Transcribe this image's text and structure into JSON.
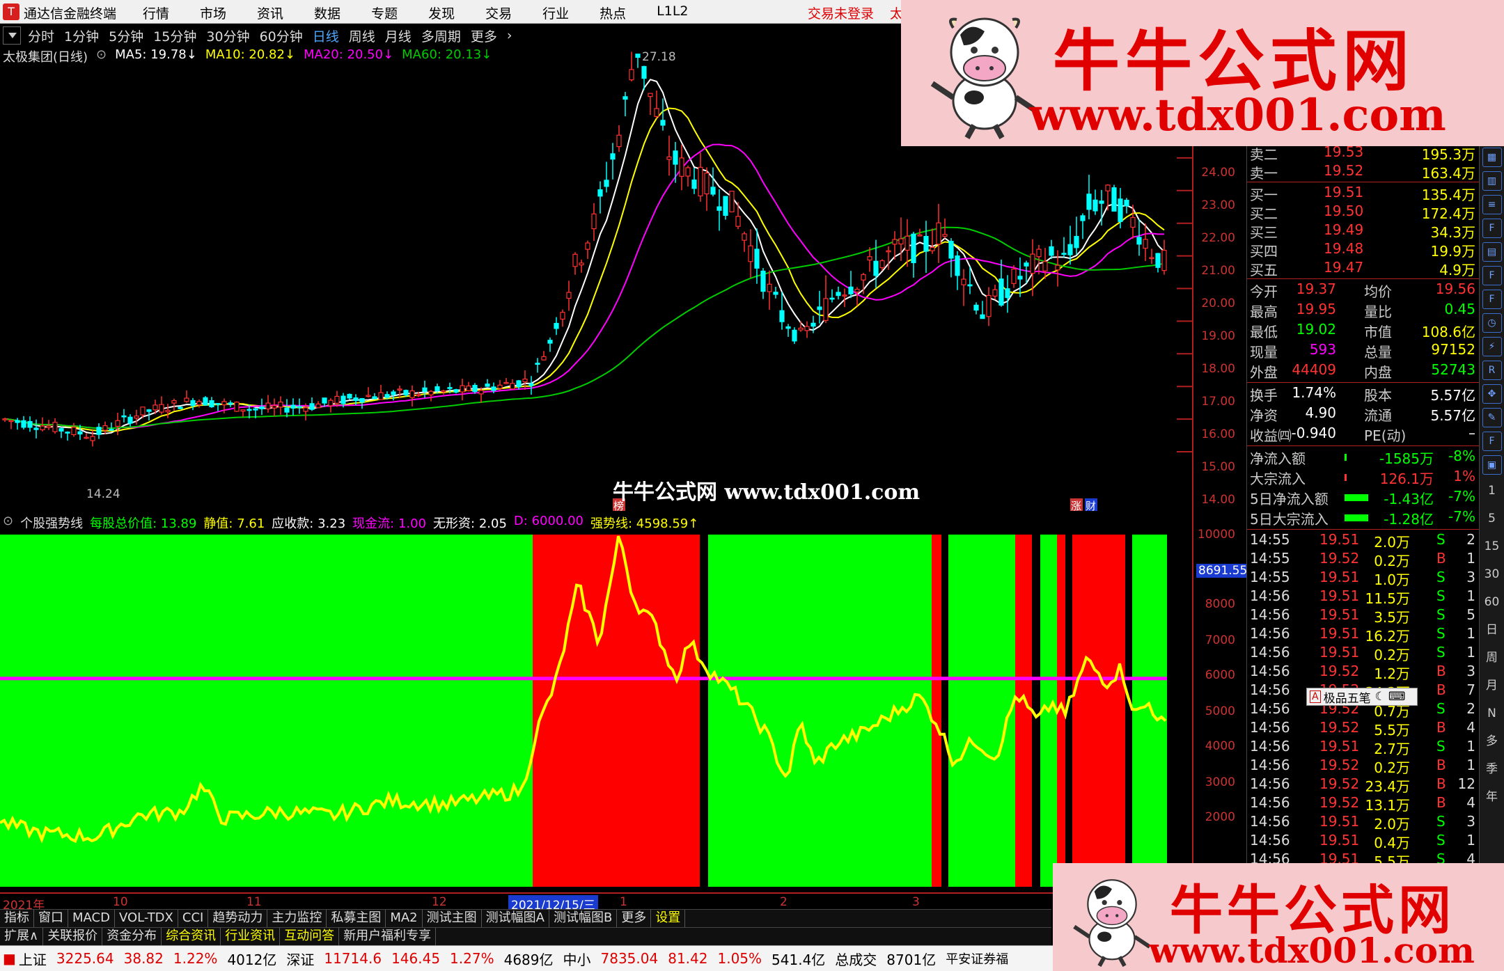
{
  "menubar": {
    "app_title": "通达信金融终端",
    "items": [
      "行情",
      "市场",
      "资讯",
      "数据",
      "专题",
      "发现",
      "交易",
      "行业",
      "热点",
      "L1L2"
    ],
    "trade_status": "交易未登录",
    "trade_status_extra": "太"
  },
  "periods": {
    "items": [
      "分时",
      "1分钟",
      "5分钟",
      "15分钟",
      "30分钟",
      "60分钟",
      "日线",
      "周线",
      "月线",
      "多周期",
      "更多"
    ],
    "active": "日线"
  },
  "main_title": {
    "stock": "太极集团(日线)",
    "ma5": "MA5: 19.78↓",
    "ma10": "MA10: 20.82↓",
    "ma20": "MA20: 20.50↓",
    "ma60": "MA60: 20.13↓",
    "high_label": "27.18",
    "low_label": "14.24",
    "badge1": "榜",
    "badge2": "涨",
    "badge3": "财"
  },
  "indicator_title": {
    "name": "个股强势线",
    "f1": "每股总价值: 13.89",
    "f2": "静值: 7.61",
    "f3": "应收款: 3.23",
    "f4": "现金流: 1.00",
    "f5": "无形资: 2.05",
    "f6": "D: 6000.00",
    "f7": "强势线: 4598.59↑",
    "current_value": "8691.55"
  },
  "axis_main": [
    "24.00",
    "23.00",
    "22.00",
    "21.00",
    "20.00",
    "19.00",
    "18.00",
    "17.00",
    "16.00",
    "15.00",
    "14.00"
  ],
  "axis_ind": [
    "10000",
    "8000",
    "7000",
    "6000",
    "5000",
    "4000",
    "3000",
    "2000"
  ],
  "dates": {
    "y": "2021年",
    "m10": "10",
    "m11": "11",
    "m12": "12",
    "sel": "2021/12/15/三",
    "m1": "1",
    "m2": "2",
    "m3": "3"
  },
  "tabs1": [
    "指标",
    "窗口",
    "MACD",
    "VOL-TDX",
    "CCI",
    "趋势动力",
    "主力监控",
    "私募主图",
    "MA2",
    "测试主图",
    "测试幅图A",
    "测试幅图B",
    "更多",
    "设置"
  ],
  "tabs2": [
    "扩展∧",
    "关联报价",
    "资金分布",
    "综合资讯",
    "行业资讯",
    "互动问答",
    "新用户福利专享"
  ],
  "statusbar": {
    "sh_label": "上证",
    "sh_val": "3225.64",
    "sh_chg": "38.82",
    "sh_pct": "1.22%",
    "sh_amt": "4012亿",
    "sz_label": "深证",
    "sz_val": "11714.6",
    "sz_chg": "146.45",
    "sz_pct": "1.27%",
    "sz_amt": "4689亿",
    "zx_label": "中小",
    "zx_val": "7835.04",
    "zx_chg": "81.42",
    "zx_pct": "1.05%",
    "zx_amt": "541.4亿",
    "total_label": "总成交",
    "total_val": "8701亿",
    "broker": "平安证券福"
  },
  "quotes": {
    "sell": [
      {
        "label": "卖二",
        "price": "19.53",
        "vol": "195.3万"
      },
      {
        "label": "卖一",
        "price": "19.52",
        "vol": "163.4万"
      }
    ],
    "buy": [
      {
        "label": "买一",
        "price": "19.51",
        "vol": "135.4万"
      },
      {
        "label": "买二",
        "price": "19.50",
        "vol": "172.4万"
      },
      {
        "label": "买三",
        "price": "19.49",
        "vol": "34.3万"
      },
      {
        "label": "买四",
        "price": "19.48",
        "vol": "19.9万"
      },
      {
        "label": "买五",
        "price": "19.47",
        "vol": "4.9万"
      }
    ],
    "stats": [
      {
        "l1": "今开",
        "v1": "19.37",
        "l2": "均价",
        "v2": "19.56"
      },
      {
        "l1": "最高",
        "v1": "19.95",
        "l2": "量比",
        "v2": "0.45"
      },
      {
        "l1": "最低",
        "v1": "19.02",
        "l2": "市值",
        "v2": "108.6亿"
      },
      {
        "l1": "现量",
        "v1": "593",
        "l2": "总量",
        "v2": "97152"
      },
      {
        "l1": "外盘",
        "v1": "44409",
        "l2": "内盘",
        "v2": "52743"
      }
    ],
    "fin": [
      {
        "l1": "换手",
        "v1": "1.74%",
        "l2": "股本",
        "v2": "5.57亿"
      },
      {
        "l1": "净资",
        "v1": "4.90",
        "l2": "流通",
        "v2": "5.57亿"
      },
      {
        "l1": "收益㈣",
        "v1": "-0.940",
        "l2": "PE(动)",
        "v2": "–"
      }
    ],
    "flow": [
      {
        "label": "净流入额",
        "val": "-1585万",
        "pct": "-8%"
      },
      {
        "label": "大宗流入",
        "val": "126.1万",
        "pct": "1%"
      },
      {
        "label": "5日净流入额",
        "val": "-1.43亿",
        "pct": "-7%"
      },
      {
        "label": "5日大宗流入",
        "val": "-1.28亿",
        "pct": "-7%"
      }
    ]
  },
  "ticks": [
    {
      "t": "14:55",
      "p": "19.51",
      "v": "2.0万",
      "s": "S",
      "n": "2"
    },
    {
      "t": "14:55",
      "p": "19.52",
      "v": "0.2万",
      "s": "B",
      "n": "1"
    },
    {
      "t": "14:55",
      "p": "19.51",
      "v": "1.0万",
      "s": "S",
      "n": "3"
    },
    {
      "t": "14:56",
      "p": "19.51",
      "v": "11.5万",
      "s": "S",
      "n": "1"
    },
    {
      "t": "14:56",
      "p": "19.51",
      "v": "3.5万",
      "s": "S",
      "n": "5"
    },
    {
      "t": "14:56",
      "p": "19.51",
      "v": "16.2万",
      "s": "S",
      "n": "1"
    },
    {
      "t": "14:56",
      "p": "19.51",
      "v": "0.2万",
      "s": "S",
      "n": "1"
    },
    {
      "t": "14:56",
      "p": "19.52",
      "v": "1.2万",
      "s": "B",
      "n": "3"
    },
    {
      "t": "14:56",
      "p": "19.52",
      "v": "34.2万",
      "s": "B",
      "n": "7"
    },
    {
      "t": "14:56",
      "p": "19.52",
      "v": "0.7万",
      "s": "S",
      "n": "2"
    },
    {
      "t": "14:56",
      "p": "19.52",
      "v": "5.5万",
      "s": "B",
      "n": "4"
    },
    {
      "t": "14:56",
      "p": "19.51",
      "v": "2.7万",
      "s": "S",
      "n": "1"
    },
    {
      "t": "14:56",
      "p": "19.52",
      "v": "0.2万",
      "s": "B",
      "n": "1"
    },
    {
      "t": "14:56",
      "p": "19.52",
      "v": "23.4万",
      "s": "B",
      "n": "12"
    },
    {
      "t": "14:56",
      "p": "19.52",
      "v": "13.1万",
      "s": "B",
      "n": "4"
    },
    {
      "t": "14:56",
      "p": "19.51",
      "v": "2.0万",
      "s": "S",
      "n": "3"
    },
    {
      "t": "14:56",
      "p": "19.51",
      "v": "0.4万",
      "s": "S",
      "n": "1"
    },
    {
      "t": "14:56",
      "p": "19.51",
      "v": "5.5万",
      "s": "S",
      "n": "4"
    }
  ],
  "popup": {
    "label": "极品五笔"
  },
  "iconstrip": [
    "1",
    "5",
    "15",
    "30",
    "60",
    "日",
    "周",
    "月",
    "N",
    "多",
    "季",
    "年"
  ],
  "ad": {
    "title": "牛牛公式网",
    "url": "www.tdx001.com"
  },
  "watermark": "牛牛公式网 www.tdx001.com",
  "colors": {
    "up": "#ff3030",
    "down": "#00ffff",
    "ma5": "#ffffff",
    "ma10": "#ffff00",
    "ma20": "#ff00ff",
    "ma60": "#00cc00",
    "green_zone": "#00ff00",
    "red_zone": "#ff0000",
    "strength_line": "#ffff00",
    "d_line": "#ff00ff"
  }
}
